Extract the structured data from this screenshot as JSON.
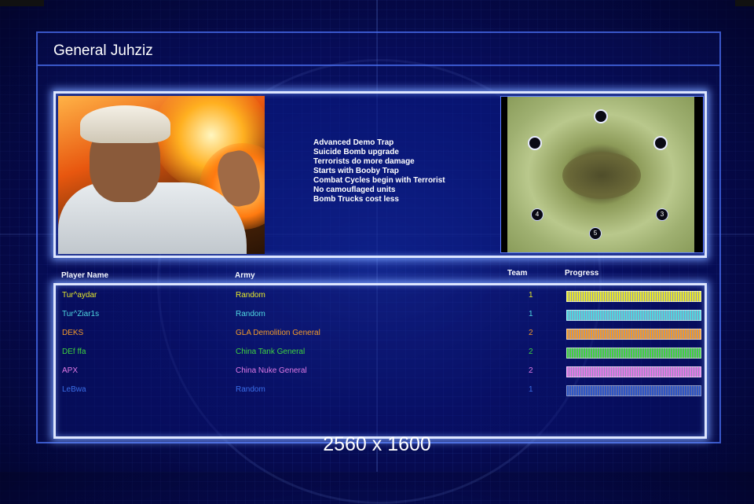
{
  "general": {
    "title": "General Juhziz",
    "traits": [
      "Advanced Demo Trap",
      "Suicide Bomb upgrade",
      "Terrorists do more damage",
      "Starts with Booby Trap",
      "Combat Cycles begin with Terrorist",
      "No camouflaged units",
      "Bomb Trucks cost less"
    ]
  },
  "minimap": {
    "spawn_labels": [
      "3",
      "4",
      "5"
    ]
  },
  "table": {
    "headers": {
      "player": "Player Name",
      "army": "Army",
      "team": "Team",
      "progress": "Progress"
    },
    "players": [
      {
        "name": "Tur^aydar",
        "army": "Random",
        "team": "1",
        "color": "#e6e82a"
      },
      {
        "name": "Tur^Ziar1s",
        "army": "Random",
        "team": "1",
        "color": "#4fd6e0"
      },
      {
        "name": "DEKS",
        "army": "GLA Demolition General",
        "team": "2",
        "color": "#f29a2a"
      },
      {
        "name": "DEf ffa",
        "army": "China Tank General",
        "team": "2",
        "color": "#3fd23f"
      },
      {
        "name": "APX",
        "army": "China Nuke General",
        "team": "2",
        "color": "#e07ae6"
      },
      {
        "name": "LeBwa",
        "army": "Random",
        "team": "1",
        "color": "#3a6ee8"
      }
    ]
  },
  "overlay": {
    "resolution": "2560 x 1600"
  }
}
